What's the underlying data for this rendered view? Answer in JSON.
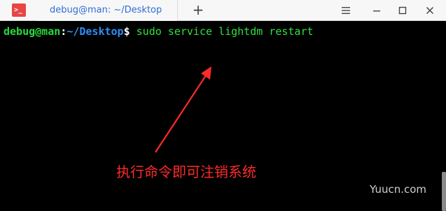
{
  "window": {
    "tab_title": "debug@man: ~/Desktop",
    "new_tab_label": "+",
    "app_icon_glyph": ">_",
    "icons": {
      "app": "terminal-icon",
      "menu": "hamburger-menu-icon",
      "minimize": "minimize-icon",
      "maximize": "maximize-icon",
      "close": "close-icon"
    }
  },
  "terminal": {
    "prompt": {
      "user_host": "debug@man",
      "colon": ":",
      "path": "~/Desktop",
      "dollar": "$",
      "command": " sudo service lightdm restart"
    },
    "colors": {
      "user": "#29d93a",
      "path": "#2f8ff5",
      "command": "#2fe03d",
      "background": "#000000"
    }
  },
  "annotation": {
    "text": "执行命令即可注销系统",
    "color": "#ff2a2a",
    "arrow_icon": "arrow-icon"
  },
  "watermark": {
    "text": "Yuucn.com"
  }
}
